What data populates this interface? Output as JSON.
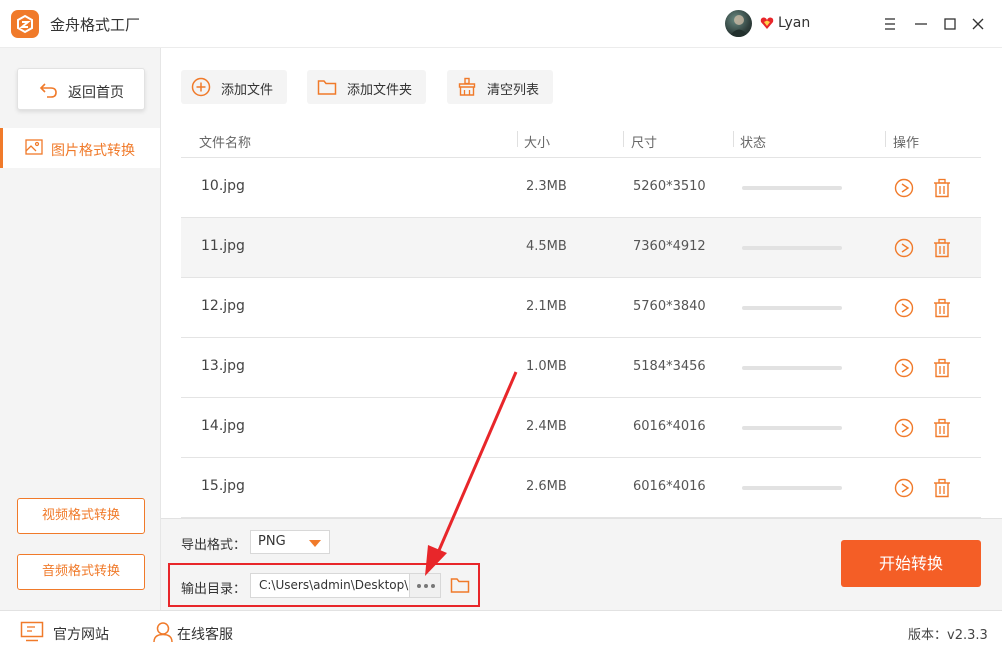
{
  "app": {
    "title": "金舟格式工厂",
    "accent_color": "#f07a2a",
    "start_color": "#f45e26"
  },
  "user": {
    "name": "Lyan",
    "vip_icon": "heart-badge-icon"
  },
  "window_controls": [
    "menu-icon",
    "minimize-icon",
    "maximize-icon",
    "close-icon"
  ],
  "sidebar": {
    "back_label": "返回首页",
    "active_item": "图片格式转换",
    "video_button": "视频格式转换",
    "audio_button": "音频格式转换"
  },
  "toolbar": {
    "add_file": "添加文件",
    "add_folder": "添加文件夹",
    "clear_list": "清空列表"
  },
  "table": {
    "columns": [
      "文件名称",
      "大小",
      "尺寸",
      "状态",
      "操作"
    ],
    "rows": [
      {
        "name": "10.jpg",
        "size": "2.3MB",
        "dimensions": "5260*3510",
        "progress": 0
      },
      {
        "name": "11.jpg",
        "size": "4.5MB",
        "dimensions": "7360*4912",
        "progress": 0
      },
      {
        "name": "12.jpg",
        "size": "2.1MB",
        "dimensions": "5760*3840",
        "progress": 0
      },
      {
        "name": "13.jpg",
        "size": "1.0MB",
        "dimensions": "5184*3456",
        "progress": 0
      },
      {
        "name": "14.jpg",
        "size": "2.4MB",
        "dimensions": "6016*4016",
        "progress": 0
      },
      {
        "name": "15.jpg",
        "size": "2.6MB",
        "dimensions": "6016*4016",
        "progress": 0
      }
    ]
  },
  "output": {
    "format_label": "导出格式：",
    "format_value": "PNG",
    "dir_label": "输出目录：",
    "dir_value": "C:\\Users\\admin\\Desktop\\"
  },
  "start_button": "开始转换",
  "footer": {
    "website": "官方网站",
    "support": "在线客服",
    "version": "版本：v2.3.3"
  }
}
